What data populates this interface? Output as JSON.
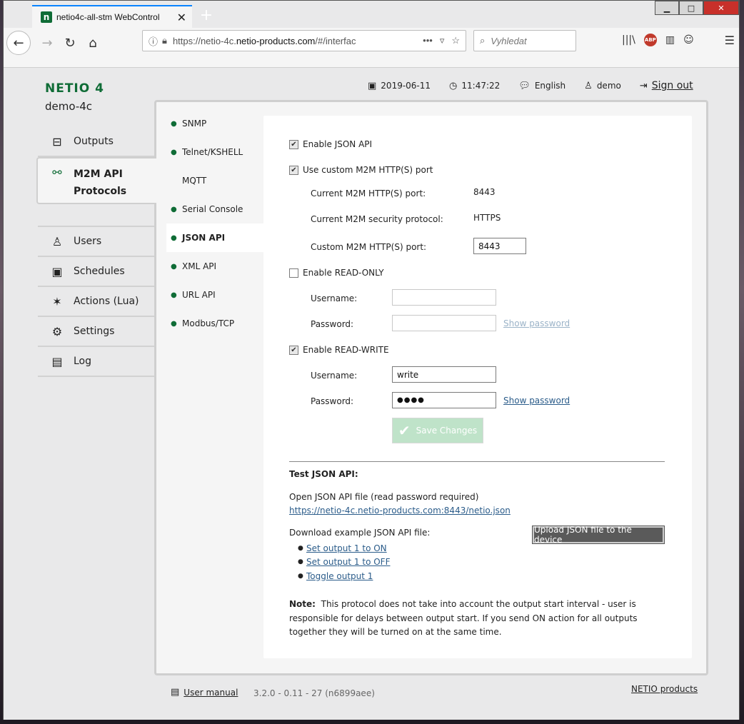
{
  "browser": {
    "tab_title": "netio4c-all-stm WebControl",
    "favicon_letter": "n",
    "new_tab": "+",
    "url_base": "https://netio-4c.",
    "url_domain": "netio-products.com",
    "url_path": "/#/interfac",
    "search_placeholder": "Vyhledat",
    "abp_label": "ABP",
    "icons": [
      "back-icon",
      "forward-icon",
      "reload-icon",
      "home-icon",
      "info-icon",
      "lock-warning-icon",
      "more-icon",
      "pocket-icon",
      "star-icon",
      "search-icon",
      "library-icon",
      "adblock-icon",
      "sidebar-icon",
      "account-icon",
      "menu-icon"
    ]
  },
  "header": {
    "brand": "NETIO 4",
    "device_name": "demo-4c",
    "date": "2019-06-11",
    "time": "11:47:22",
    "language": "English",
    "user": "demo",
    "sign_out": "Sign out"
  },
  "main_nav": {
    "items": [
      {
        "label": "Outputs",
        "icon": "outputs-icon"
      },
      {
        "label1": "M2M API",
        "label2": "Protocols",
        "icon": "m2m-icon",
        "active": true
      },
      {
        "label": "Users",
        "icon": "user-icon"
      },
      {
        "label": "Schedules",
        "icon": "calendar-icon"
      },
      {
        "label": "Actions (Lua)",
        "icon": "wand-icon"
      },
      {
        "label": "Settings",
        "icon": "gear-icon"
      },
      {
        "label": "Log",
        "icon": "document-icon"
      }
    ]
  },
  "sub_nav": {
    "items": [
      {
        "label": "SNMP",
        "enabled": true
      },
      {
        "label": "Telnet/KSHELL",
        "enabled": true
      },
      {
        "label": "MQTT",
        "enabled": false
      },
      {
        "label": "Serial Console",
        "enabled": true
      },
      {
        "label": "JSON API",
        "enabled": true,
        "active": true
      },
      {
        "label": "XML API",
        "enabled": true
      },
      {
        "label": "URL API",
        "enabled": true
      },
      {
        "label": "Modbus/TCP",
        "enabled": true
      }
    ]
  },
  "form": {
    "enable_json_api": {
      "label": "Enable JSON API",
      "checked": true
    },
    "use_custom_port": {
      "label": "Use custom M2M HTTP(S) port",
      "checked": true
    },
    "current_port_label": "Current M2M HTTP(S) port:",
    "current_port_value": "8443",
    "security_protocol_label": "Current M2M security protocol:",
    "security_protocol_value": "HTTPS",
    "custom_port_label": "Custom M2M HTTP(S) port:",
    "custom_port_value": "8443",
    "read_only": {
      "label": "Enable READ-ONLY",
      "checked": false,
      "username_label": "Username:",
      "username_value": "",
      "password_label": "Password:",
      "password_value": "",
      "show_password": "Show password"
    },
    "read_write": {
      "label": "Enable READ-WRITE",
      "checked": true,
      "username_label": "Username:",
      "username_value": "write",
      "password_label": "Password:",
      "password_value": "●●●●",
      "show_password": "Show password"
    },
    "save_button": "Save Changes"
  },
  "test": {
    "title": "Test JSON API:",
    "open_label": "Open JSON API file (read password required)",
    "open_link": "https://netio-4c.netio-products.com:8443/netio.json",
    "download_label": "Download example JSON API file:",
    "examples": [
      "Set output 1 to ON",
      "Set output 1 to OFF",
      "Toggle output 1"
    ],
    "upload_button": "Upload JSON file to the device",
    "note_label": "Note:",
    "note_text": "This protocol does not take into account the output start interval - user is responsible for delays between output start. If you send ON action for all outputs together they will be turned on at the same time."
  },
  "footer": {
    "user_manual": "User manual",
    "version": "3.2.0 - 0.11 - 27 (n6899aee)",
    "netio_products": "NETIO products"
  },
  "colors": {
    "brand_green": "#0f6c36",
    "link_blue": "#2b5c8a",
    "save_disabled": "#bfe3c9",
    "upload_dark": "#5a5a5a"
  }
}
